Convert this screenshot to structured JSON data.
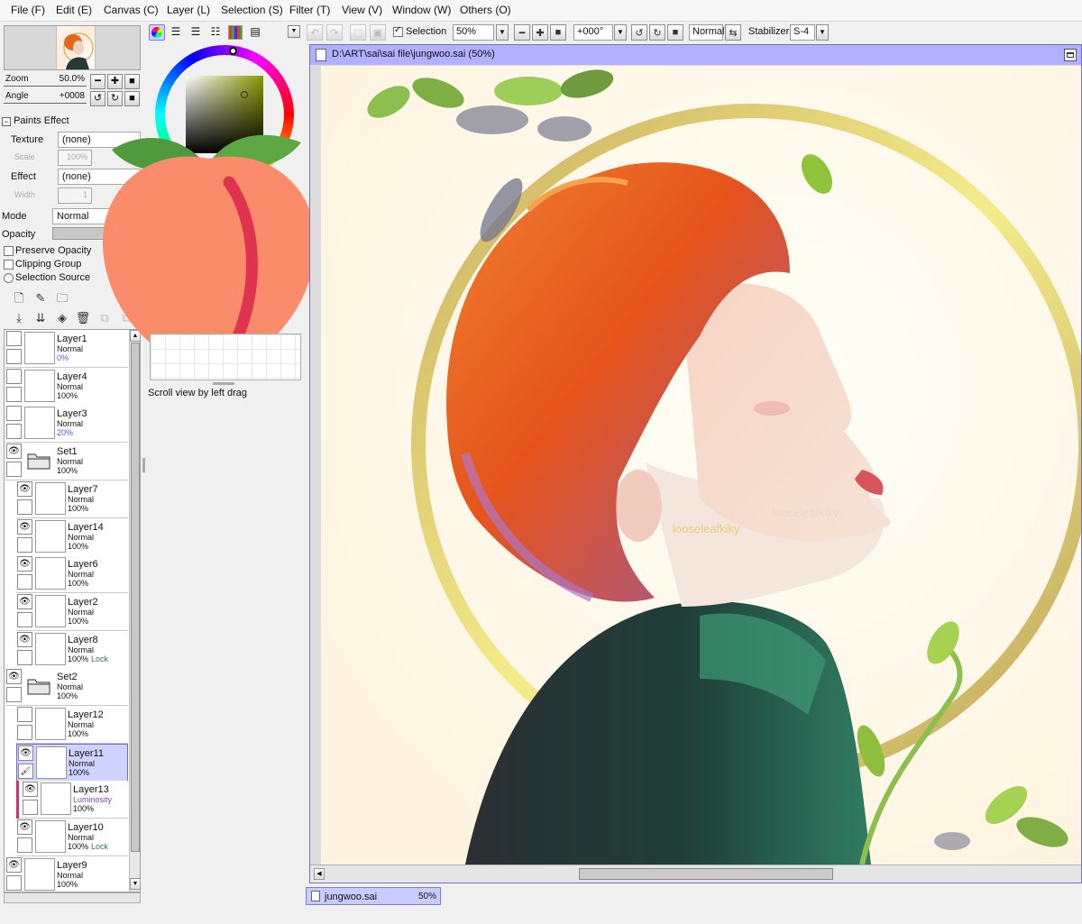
{
  "menubar": {
    "items": [
      "File (F)",
      "Edit (E)",
      "Canvas (C)",
      "Layer (L)",
      "Selection (S)",
      "Filter (T)",
      "View (V)",
      "Window (W)",
      "Others (O)"
    ]
  },
  "toolbar": {
    "selection_label": "Selection",
    "zoom_value": "50%",
    "angle_value": "+000°",
    "blend_mode": "Normal",
    "stabilizer_label": "Stabilizer",
    "stabilizer_value": "S-4"
  },
  "navigator": {
    "zoom_label": "Zoom",
    "zoom_value": "50.0%",
    "angle_label": "Angle",
    "angle_value": "+0008"
  },
  "paint_effect": {
    "header": "Paints Effect",
    "texture_label": "Texture",
    "texture_value": "(none)",
    "scale_label": "Scale",
    "scale_value": "100%",
    "effect_label": "Effect",
    "effect_value": "(none)",
    "width_label": "Width",
    "width_value": "1"
  },
  "layer_props": {
    "mode_label": "Mode",
    "mode_value": "Normal",
    "opacity_label": "Opacity",
    "preserve_opacity": "Preserve Opacity",
    "clipping_group": "Clipping Group",
    "selection_source": "Selection Source"
  },
  "scratchpad_hint": "Scroll view by left drag",
  "layers": [
    {
      "name": "Layer1",
      "mode": "Normal",
      "opacity": "0%",
      "lock": "",
      "visible": false,
      "folder": false,
      "indent": false,
      "selected": false,
      "clip": false,
      "op_blue": true
    },
    {
      "name": "Layer4",
      "mode": "Normal",
      "opacity": "100%",
      "lock": "",
      "visible": false,
      "folder": false,
      "indent": false,
      "selected": false,
      "clip": false,
      "op_blue": false
    },
    {
      "name": "Layer3",
      "mode": "Normal",
      "opacity": "20%",
      "lock": "",
      "visible": false,
      "folder": false,
      "indent": false,
      "selected": false,
      "clip": false,
      "op_blue": true
    },
    {
      "name": "Set1",
      "mode": "Normal",
      "opacity": "100%",
      "lock": "",
      "visible": true,
      "folder": true,
      "indent": false,
      "selected": false,
      "clip": false,
      "op_blue": false
    },
    {
      "name": "Layer7",
      "mode": "Normal",
      "opacity": "100%",
      "lock": "",
      "visible": true,
      "folder": false,
      "indent": true,
      "selected": false,
      "clip": false,
      "op_blue": false
    },
    {
      "name": "Layer14",
      "mode": "Normal",
      "opacity": "100%",
      "lock": "",
      "visible": true,
      "folder": false,
      "indent": true,
      "selected": false,
      "clip": false,
      "op_blue": false
    },
    {
      "name": "Layer6",
      "mode": "Normal",
      "opacity": "100%",
      "lock": "",
      "visible": true,
      "folder": false,
      "indent": true,
      "selected": false,
      "clip": false,
      "op_blue": false
    },
    {
      "name": "Layer2",
      "mode": "Normal",
      "opacity": "100%",
      "lock": "",
      "visible": true,
      "folder": false,
      "indent": true,
      "selected": false,
      "clip": false,
      "op_blue": false
    },
    {
      "name": "Layer8",
      "mode": "Normal",
      "opacity": "100%",
      "lock": "Lock",
      "visible": true,
      "folder": false,
      "indent": true,
      "selected": false,
      "clip": false,
      "op_blue": false
    },
    {
      "name": "Set2",
      "mode": "Normal",
      "opacity": "100%",
      "lock": "",
      "visible": true,
      "folder": true,
      "indent": false,
      "selected": false,
      "clip": false,
      "op_blue": false
    },
    {
      "name": "Layer12",
      "mode": "Normal",
      "opacity": "100%",
      "lock": "",
      "visible": false,
      "folder": false,
      "indent": true,
      "selected": false,
      "clip": false,
      "op_blue": false
    },
    {
      "name": "Layer11",
      "mode": "Normal",
      "opacity": "100%",
      "lock": "",
      "visible": true,
      "folder": false,
      "indent": true,
      "selected": true,
      "clip": false,
      "op_blue": false
    },
    {
      "name": "Layer13",
      "mode": "Luminosity",
      "opacity": "100%",
      "lock": "",
      "visible": true,
      "folder": false,
      "indent": true,
      "selected": false,
      "clip": true,
      "op_blue": false
    },
    {
      "name": "Layer10",
      "mode": "Normal",
      "opacity": "100%",
      "lock": "Lock",
      "visible": true,
      "folder": false,
      "indent": true,
      "selected": false,
      "clip": false,
      "op_blue": false
    },
    {
      "name": "Layer9",
      "mode": "Normal",
      "opacity": "100%",
      "lock": "",
      "visible": true,
      "folder": false,
      "indent": false,
      "selected": false,
      "clip": false,
      "op_blue": false
    }
  ],
  "canvas": {
    "title": "D:\\ART\\sai\\sai file\\jungwoo.sai (50%)",
    "watermark_1": "looseleafkiky",
    "watermark_2": "looseleafkiky"
  },
  "doc_tab": {
    "name": "jungwoo.sai",
    "zoom": "50%"
  },
  "colors": {
    "title_bar": "#b1b1ff",
    "selected_layer": "#cfd3ff",
    "clip_marker": "#d0306a",
    "opacity_blue": "#3b62c9",
    "luminosity_purple": "#8a3fbf",
    "lock_green": "#2a7a4a"
  }
}
